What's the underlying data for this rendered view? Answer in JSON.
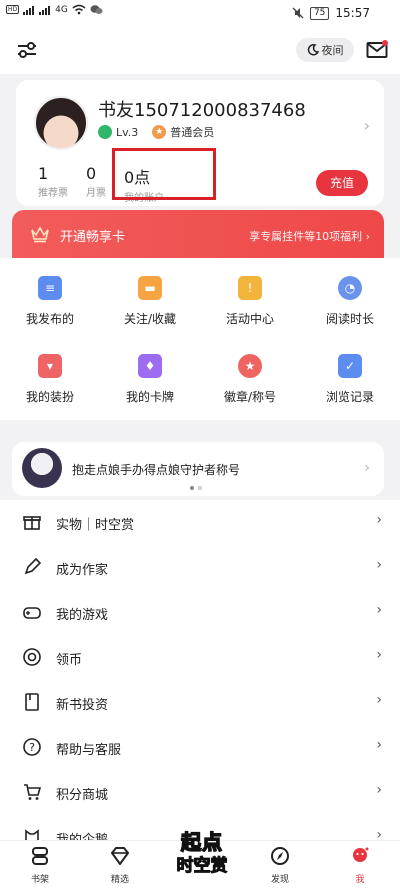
{
  "status_bar": {
    "time": "15:57",
    "battery": "75",
    "net_label": "4G"
  },
  "topbar": {
    "night_label": "夜间"
  },
  "account": {
    "username": "书友150712000837468",
    "level": "Lv.3",
    "membership": "普通会员",
    "stats": [
      {
        "num": "1",
        "label": "推荐票"
      },
      {
        "num": "0",
        "label": "月票"
      },
      {
        "num": "0点",
        "label": "我的账户"
      }
    ],
    "charge_label": "充值"
  },
  "banner": {
    "title": "开通畅享卡",
    "benefit": "享专属挂件等10项福利 ›"
  },
  "grid": {
    "items": [
      {
        "label": "我发布的",
        "icon": "post-icon",
        "color": "#5c8cf0"
      },
      {
        "label": "关注/收藏",
        "icon": "folder-icon",
        "color": "#f5a441"
      },
      {
        "label": "活动中心",
        "icon": "gift-box-icon",
        "color": "#f2b43c"
      },
      {
        "label": "阅读时长",
        "icon": "clock-icon",
        "color": "#6a94ec"
      },
      {
        "label": "我的装扮",
        "icon": "tshirt-icon",
        "color": "#ef6464"
      },
      {
        "label": "我的卡牌",
        "icon": "card-icon",
        "color": "#9d6cf0"
      },
      {
        "label": "徽章/称号",
        "icon": "medal-icon",
        "color": "#ee6461"
      },
      {
        "label": "浏览记录",
        "icon": "history-icon",
        "color": "#5c8cf0"
      }
    ]
  },
  "promo": {
    "text": "抱走点娘手办得点娘守护者称号"
  },
  "menu": {
    "items": [
      {
        "label": "实物｜时空赏",
        "icon": "gift-icon"
      },
      {
        "label": "成为作家",
        "icon": "pen-icon"
      },
      {
        "label": "我的游戏",
        "icon": "gamepad-icon"
      },
      {
        "label": "领币",
        "icon": "coin-icon"
      },
      {
        "label": "新书投资",
        "icon": "book-invest-icon"
      },
      {
        "label": "帮助与客服",
        "icon": "help-icon"
      },
      {
        "label": "积分商城",
        "icon": "cart-icon"
      },
      {
        "label": "我的企鹅",
        "icon": "penguin-icon"
      }
    ]
  },
  "bottom_nav": {
    "items": [
      {
        "label": "书架"
      },
      {
        "label": "精选"
      },
      {
        "label": "发现"
      },
      {
        "label": "我"
      }
    ],
    "center_logo": {
      "line1": "起点",
      "line2": "时空赏"
    }
  },
  "colors": {
    "accent": "#e8343e",
    "highlight_box": "#d92027"
  }
}
